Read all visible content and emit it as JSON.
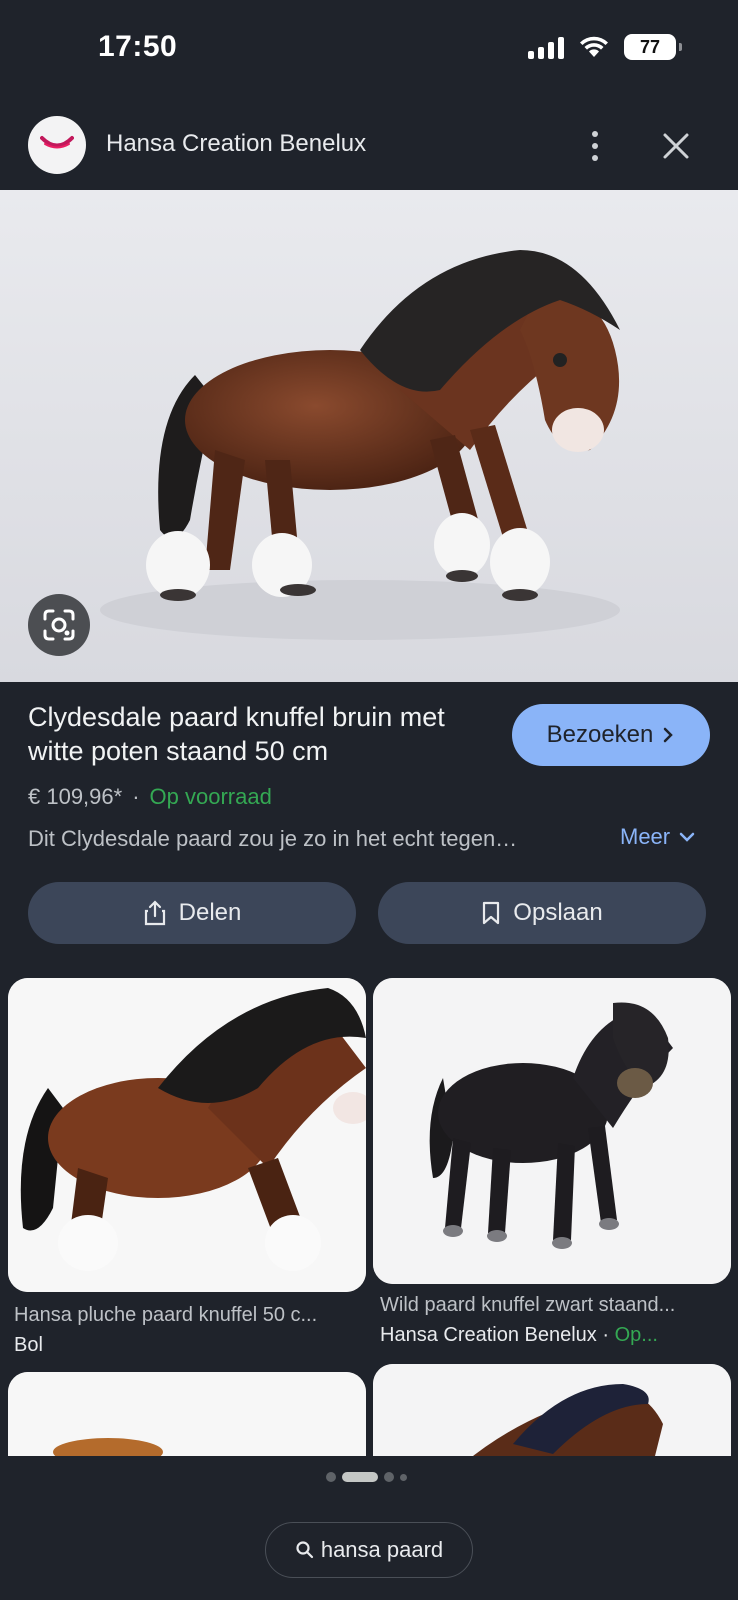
{
  "status_bar": {
    "time": "17:50",
    "battery": "77"
  },
  "header": {
    "site_name": "Hansa Creation Benelux"
  },
  "product": {
    "title": "Clydesdale paard knuffel bruin met witte poten staand 50 cm",
    "visit_label": "Bezoeken",
    "price": "€ 109,96*",
    "separator": "·",
    "stock": "Op voorraad",
    "description": "Dit Clydesdale paard zou je zo in het echt tegen…",
    "more_label": "Meer",
    "share_label": "Delen",
    "save_label": "Opslaan"
  },
  "results": [
    {
      "caption": "Hansa pluche paard knuffel 50 c...",
      "source": "Bol"
    },
    {
      "caption": "Wild paard knuffel zwart staand...",
      "source": "Hansa Creation Benelux",
      "stock_short": "Op..."
    }
  ],
  "search": {
    "query": "hansa paard"
  },
  "colors": {
    "accent": "#8ab4f8",
    "stock_green": "#34a853",
    "background": "#1f232b"
  }
}
